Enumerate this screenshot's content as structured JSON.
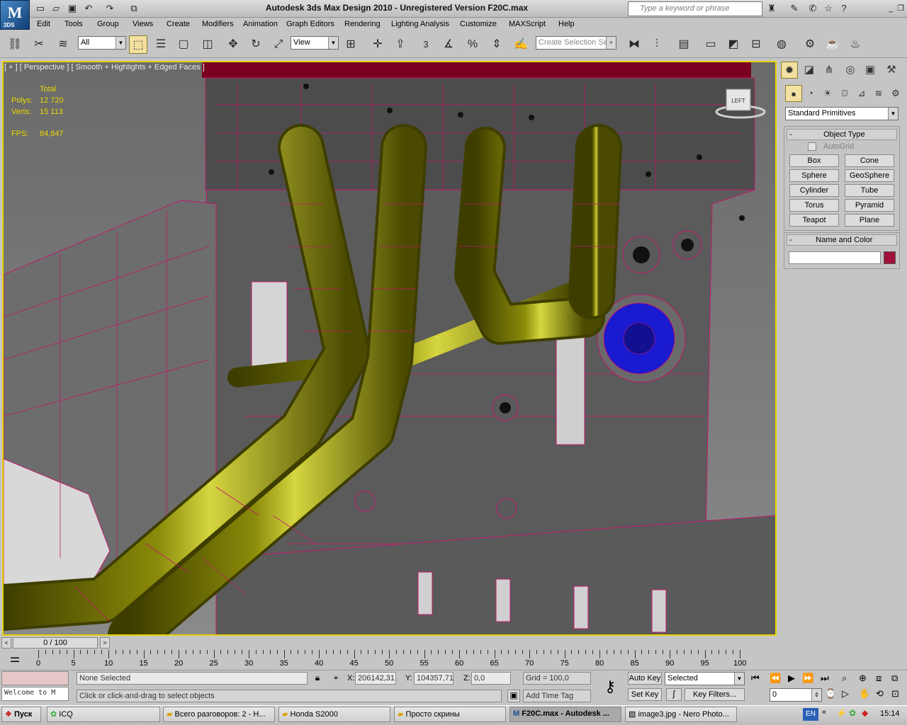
{
  "app": {
    "title": "Autodesk 3ds Max Design 2010  - Unregistered Version     F20C.max",
    "logo_text": "3DS",
    "search_placeholder": "Type a keyword or phrase"
  },
  "menu": [
    "Edit",
    "Tools",
    "Group",
    "Views",
    "Create",
    "Modifiers",
    "Animation",
    "Graph Editors",
    "Rendering",
    "Lighting Analysis",
    "Customize",
    "MAXScript",
    "Help"
  ],
  "toolbar": {
    "filter_value": "All",
    "coord_value": "View",
    "snap_label": "3",
    "selection_set_placeholder": "Create Selection Se"
  },
  "viewport": {
    "label": "[ + ] [ Perspective ] [ Smooth + Highlights + Edged Faces ]",
    "viewcube_label": "LEFT",
    "stats": {
      "total_label": "Total",
      "polys_label": "Polys:",
      "polys_value": "12 720",
      "verts_label": "Verts:",
      "verts_value": "15 113",
      "fps_label": "FPS:",
      "fps_value": "84,847"
    }
  },
  "command_panel": {
    "dropdown": "Standard Primitives",
    "object_type_title": "Object Type",
    "autogrid_label": "AutoGrid",
    "buttons": [
      "Box",
      "Cone",
      "Sphere",
      "GeoSphere",
      "Cylinder",
      "Tube",
      "Torus",
      "Pyramid",
      "Teapot",
      "Plane"
    ],
    "name_color_title": "Name and Color",
    "name_value": "",
    "color_swatch": "#a0103a"
  },
  "timeline": {
    "frame_display": "0 / 100",
    "ticks": [
      "0",
      "5",
      "10",
      "15",
      "20",
      "25",
      "30",
      "35",
      "40",
      "45",
      "50",
      "55",
      "60",
      "65",
      "70",
      "75",
      "80",
      "85",
      "90",
      "95",
      "100"
    ]
  },
  "status": {
    "maxscript_text": "Welcome to M",
    "selection_text": "None Selected",
    "prompt_text": "Click or click-and-drag to select objects",
    "x_label": "X:",
    "x_value": "206142,31",
    "y_label": "Y:",
    "y_value": "104357,71",
    "z_label": "Z:",
    "z_value": "0,0",
    "grid_text": "Grid = 100,0",
    "add_time_tag": "Add Time Tag",
    "auto_key": "Auto Key",
    "set_key": "Set Key",
    "key_mode_value": "Selected",
    "key_filters": "Key Filters...",
    "frame_value": "0"
  },
  "taskbar": {
    "start": "Пуск",
    "tasks": [
      "ICQ",
      "Всего разговоров: 2 - Н...",
      "Honda S2000",
      "Просто скрины",
      "F20C.max - Autodesk ...",
      "image3.jpg - Nero Photo..."
    ],
    "language": "EN",
    "clock": "15:14"
  },
  "colors": {
    "wire": "#c0186a",
    "pipe": "#6b6b00",
    "viewport_border": "#e7d300",
    "selection_blue": "#1a1ad0"
  }
}
